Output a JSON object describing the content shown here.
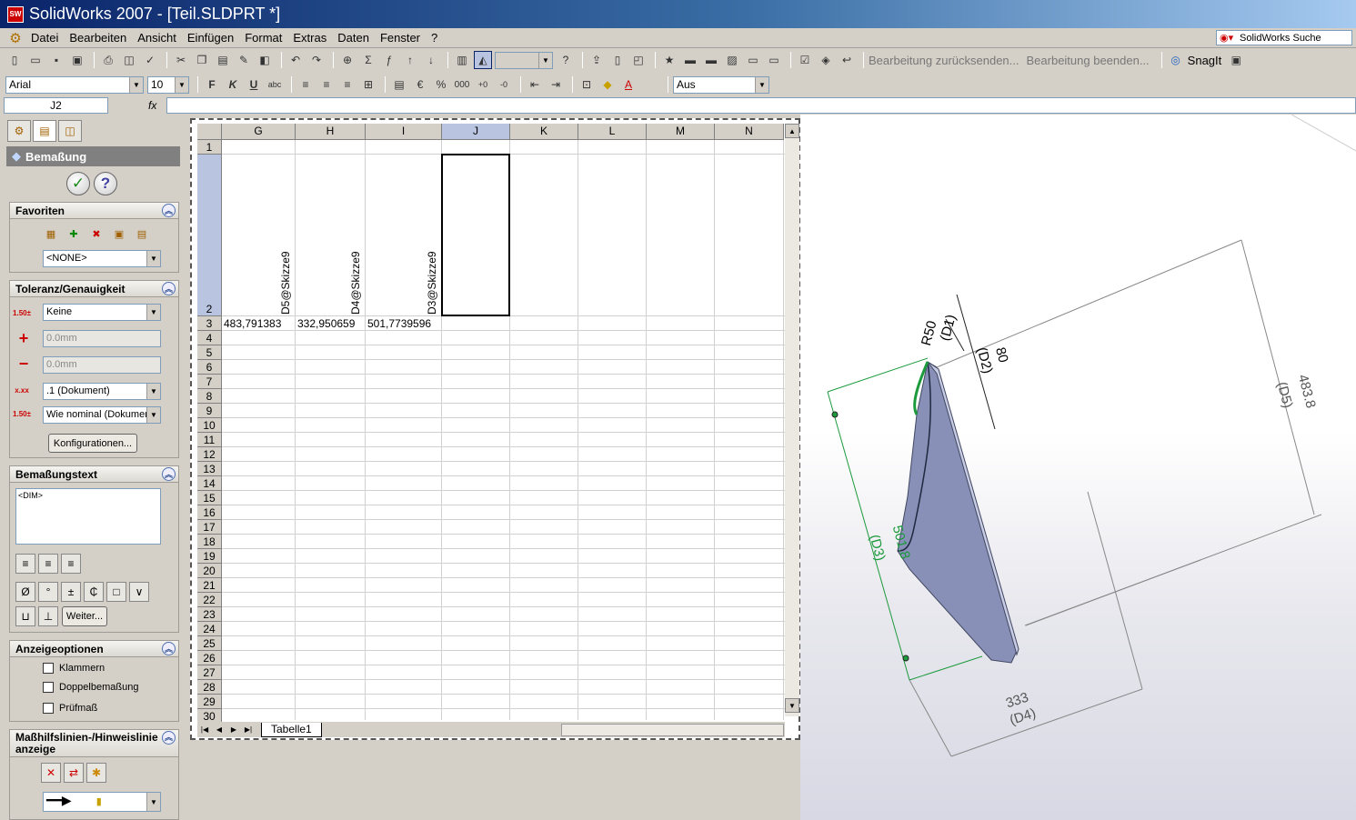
{
  "window": {
    "title": "SolidWorks 2007 - [Teil.SLDPRT *]",
    "app_icon": "SW"
  },
  "menu": [
    "Datei",
    "Bearbeiten",
    "Ansicht",
    "Einfügen",
    "Format",
    "Extras",
    "Daten",
    "Fenster",
    "?"
  ],
  "search": {
    "label": "SolidWorks Suche"
  },
  "toolbar1": {
    "review_send": "Bearbeitung zurücksenden...",
    "review_end": "Bearbeitung beenden...",
    "snagit": "SnagIt"
  },
  "toolbar2": {
    "font": "Arial",
    "size": "10",
    "bold": "F",
    "italic": "K",
    "underline": "U",
    "currency": "€",
    "percent": "%",
    "thousands": "000",
    "zoom_select": "Aus"
  },
  "formula_bar": {
    "name_box": "J2",
    "fx": "fx",
    "content": ""
  },
  "property_manager": {
    "title": "Bemaßung",
    "favorites": {
      "header": "Favoriten",
      "select": "<NONE>"
    },
    "tolerance": {
      "header": "Toleranz/Genauigkeit",
      "type": "Keine",
      "plus_value": "0.0mm",
      "minus_value": "0.0mm",
      "precision": ".1 (Dokument)",
      "tolerance_precision": "Wie nominal (Dokumen",
      "config_button": "Konfigurationen..."
    },
    "dimtext": {
      "header": "Bemaßungstext",
      "text": "<DIM>",
      "more_button": "Weiter..."
    },
    "display": {
      "header": "Anzeigeoptionen",
      "options": [
        "Klammern",
        "Doppelbemaßung",
        "Prüfmaß"
      ]
    },
    "leader": {
      "header": "Maßhilfslinien-/Hinweislinie anzeige"
    }
  },
  "sheet": {
    "columns": [
      "G",
      "H",
      "I",
      "J",
      "K",
      "L",
      "M",
      "N"
    ],
    "selected_column": "J",
    "rows": [
      "1",
      "2",
      "3",
      "4",
      "5",
      "6",
      "7",
      "8",
      "9",
      "10",
      "11",
      "12",
      "13",
      "14",
      "15",
      "16",
      "17",
      "18",
      "19",
      "20",
      "21",
      "22",
      "23",
      "24",
      "25",
      "26",
      "27",
      "28",
      "29",
      "30"
    ],
    "headers": [
      "D5@Skizze9",
      "D4@Skizze9",
      "D3@Skizze9"
    ],
    "values": [
      "483,791383",
      "332,950659",
      "501,7739596"
    ],
    "tab_name": "Tabelle1"
  },
  "viewport": {
    "dims": {
      "r50": "R50",
      "d1": "(D1)",
      "v80": "80",
      "d2": "(D2)",
      "v483": "483.8",
      "d5": "(D5)",
      "v501": "501.8",
      "d3": "(D3)",
      "v333": "333",
      "d4": "(D4)"
    }
  }
}
